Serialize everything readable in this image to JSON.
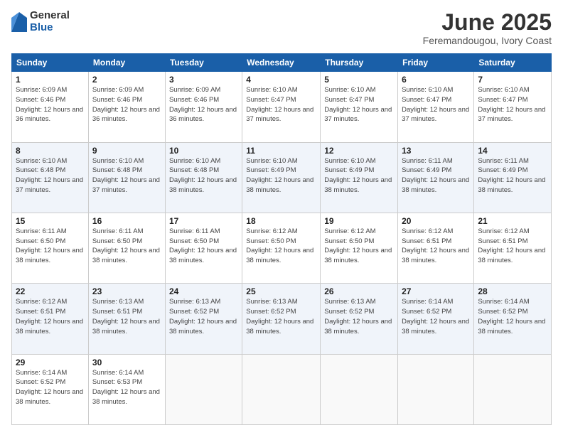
{
  "logo": {
    "general": "General",
    "blue": "Blue"
  },
  "title": "June 2025",
  "location": "Feremandougou, Ivory Coast",
  "days_of_week": [
    "Sunday",
    "Monday",
    "Tuesday",
    "Wednesday",
    "Thursday",
    "Friday",
    "Saturday"
  ],
  "weeks": [
    [
      {
        "day": "1",
        "sunrise": "6:09 AM",
        "sunset": "6:46 PM",
        "daylight": "12 hours and 36 minutes."
      },
      {
        "day": "2",
        "sunrise": "6:09 AM",
        "sunset": "6:46 PM",
        "daylight": "12 hours and 36 minutes."
      },
      {
        "day": "3",
        "sunrise": "6:09 AM",
        "sunset": "6:46 PM",
        "daylight": "12 hours and 36 minutes."
      },
      {
        "day": "4",
        "sunrise": "6:10 AM",
        "sunset": "6:47 PM",
        "daylight": "12 hours and 37 minutes."
      },
      {
        "day": "5",
        "sunrise": "6:10 AM",
        "sunset": "6:47 PM",
        "daylight": "12 hours and 37 minutes."
      },
      {
        "day": "6",
        "sunrise": "6:10 AM",
        "sunset": "6:47 PM",
        "daylight": "12 hours and 37 minutes."
      },
      {
        "day": "7",
        "sunrise": "6:10 AM",
        "sunset": "6:47 PM",
        "daylight": "12 hours and 37 minutes."
      }
    ],
    [
      {
        "day": "8",
        "sunrise": "6:10 AM",
        "sunset": "6:48 PM",
        "daylight": "12 hours and 37 minutes."
      },
      {
        "day": "9",
        "sunrise": "6:10 AM",
        "sunset": "6:48 PM",
        "daylight": "12 hours and 37 minutes."
      },
      {
        "day": "10",
        "sunrise": "6:10 AM",
        "sunset": "6:48 PM",
        "daylight": "12 hours and 38 minutes."
      },
      {
        "day": "11",
        "sunrise": "6:10 AM",
        "sunset": "6:49 PM",
        "daylight": "12 hours and 38 minutes."
      },
      {
        "day": "12",
        "sunrise": "6:10 AM",
        "sunset": "6:49 PM",
        "daylight": "12 hours and 38 minutes."
      },
      {
        "day": "13",
        "sunrise": "6:11 AM",
        "sunset": "6:49 PM",
        "daylight": "12 hours and 38 minutes."
      },
      {
        "day": "14",
        "sunrise": "6:11 AM",
        "sunset": "6:49 PM",
        "daylight": "12 hours and 38 minutes."
      }
    ],
    [
      {
        "day": "15",
        "sunrise": "6:11 AM",
        "sunset": "6:50 PM",
        "daylight": "12 hours and 38 minutes."
      },
      {
        "day": "16",
        "sunrise": "6:11 AM",
        "sunset": "6:50 PM",
        "daylight": "12 hours and 38 minutes."
      },
      {
        "day": "17",
        "sunrise": "6:11 AM",
        "sunset": "6:50 PM",
        "daylight": "12 hours and 38 minutes."
      },
      {
        "day": "18",
        "sunrise": "6:12 AM",
        "sunset": "6:50 PM",
        "daylight": "12 hours and 38 minutes."
      },
      {
        "day": "19",
        "sunrise": "6:12 AM",
        "sunset": "6:50 PM",
        "daylight": "12 hours and 38 minutes."
      },
      {
        "day": "20",
        "sunrise": "6:12 AM",
        "sunset": "6:51 PM",
        "daylight": "12 hours and 38 minutes."
      },
      {
        "day": "21",
        "sunrise": "6:12 AM",
        "sunset": "6:51 PM",
        "daylight": "12 hours and 38 minutes."
      }
    ],
    [
      {
        "day": "22",
        "sunrise": "6:12 AM",
        "sunset": "6:51 PM",
        "daylight": "12 hours and 38 minutes."
      },
      {
        "day": "23",
        "sunrise": "6:13 AM",
        "sunset": "6:51 PM",
        "daylight": "12 hours and 38 minutes."
      },
      {
        "day": "24",
        "sunrise": "6:13 AM",
        "sunset": "6:52 PM",
        "daylight": "12 hours and 38 minutes."
      },
      {
        "day": "25",
        "sunrise": "6:13 AM",
        "sunset": "6:52 PM",
        "daylight": "12 hours and 38 minutes."
      },
      {
        "day": "26",
        "sunrise": "6:13 AM",
        "sunset": "6:52 PM",
        "daylight": "12 hours and 38 minutes."
      },
      {
        "day": "27",
        "sunrise": "6:14 AM",
        "sunset": "6:52 PM",
        "daylight": "12 hours and 38 minutes."
      },
      {
        "day": "28",
        "sunrise": "6:14 AM",
        "sunset": "6:52 PM",
        "daylight": "12 hours and 38 minutes."
      }
    ],
    [
      {
        "day": "29",
        "sunrise": "6:14 AM",
        "sunset": "6:52 PM",
        "daylight": "12 hours and 38 minutes."
      },
      {
        "day": "30",
        "sunrise": "6:14 AM",
        "sunset": "6:53 PM",
        "daylight": "12 hours and 38 minutes."
      },
      null,
      null,
      null,
      null,
      null
    ]
  ],
  "labels": {
    "sunrise": "Sunrise:",
    "sunset": "Sunset:",
    "daylight": "Daylight:"
  }
}
